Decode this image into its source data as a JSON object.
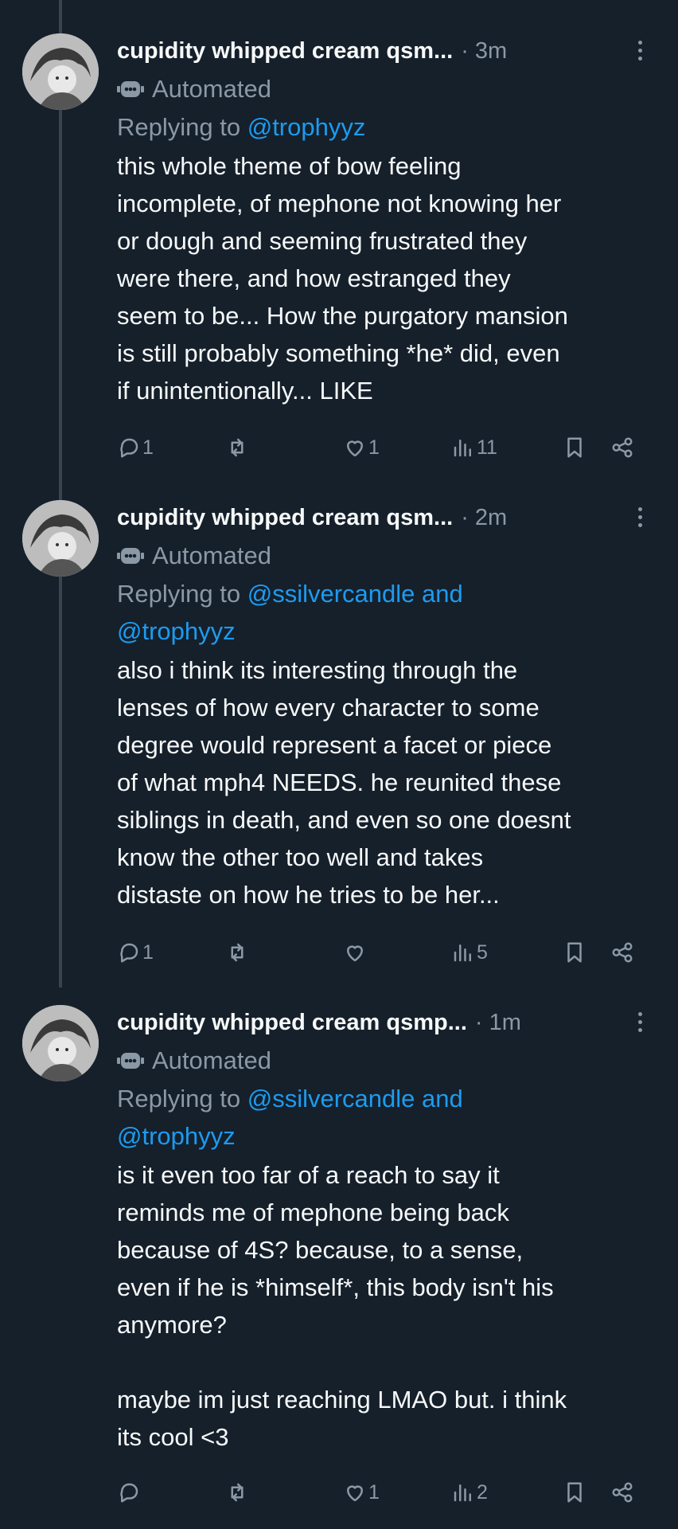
{
  "tweets": [
    {
      "author": "cupidity whipped cream qsm...",
      "time": "· 3m",
      "automated": "Automated",
      "replying_prefix": "Replying to",
      "replying_handles": "@trophyyz",
      "replying_handles_line2": "",
      "text": "this whole theme of bow feeling\nincomplete, of mephone not knowing her\nor dough and seeming frustrated they\nwere there, and how estranged they\nseem to be... How the purgatory mansion\nis still probably something *he* did, even\nif unintentionally... LIKE",
      "replies": "1",
      "retweets": "",
      "likes": "1",
      "views": "11"
    },
    {
      "author": "cupidity whipped cream qsm...",
      "time": "· 2m",
      "automated": "Automated",
      "replying_prefix": "Replying to",
      "replying_handles": "@ssilvercandle and",
      "replying_handles_line2": "@trophyyz",
      "text": "also i think its interesting through the\nlenses of how every character to some\ndegree would represent a facet or piece\nof what mph4 NEEDS. he reunited these\nsiblings in death, and even so one doesnt\nknow the other too well and takes\ndistaste on how he tries to be her...",
      "replies": "1",
      "retweets": "",
      "likes": "",
      "views": "5"
    },
    {
      "author": "cupidity whipped cream qsmp...",
      "time": "· 1m",
      "automated": "Automated",
      "replying_prefix": "Replying to",
      "replying_handles": "@ssilvercandle and",
      "replying_handles_line2": "@trophyyz",
      "text": "is it even too far of a reach to say it\nreminds me of mephone being back\nbecause of 4S? because, to a sense,\neven if he is *himself*, this body isn't his\nanymore?\n\nmaybe im just reaching LMAO but. i think\nits cool <3",
      "replies": "",
      "retweets": "",
      "likes": "1",
      "views": "2"
    }
  ],
  "icons": {
    "reply": "reply-icon",
    "retweet": "retweet-icon",
    "like": "heart-icon",
    "views": "views-icon",
    "bookmark": "bookmark-icon",
    "share": "share-icon",
    "more": "more-icon",
    "bot": "bot-icon"
  },
  "colors": {
    "background": "#15202b",
    "text": "#f7f9f9",
    "secondary": "#8b98a5",
    "accent": "#1d9bf0"
  }
}
